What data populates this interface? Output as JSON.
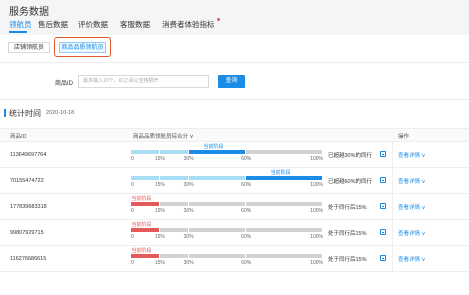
{
  "page_title": "服务数据",
  "nav": {
    "tabs": [
      "领航员",
      "售后数据",
      "评价数据",
      "客服数据",
      "消费者体验指标"
    ]
  },
  "subtabs": [
    "店铺领航员",
    "商品品质领航员"
  ],
  "search": {
    "label": "商品ID",
    "placeholder": "最多输入10个，ID之间以空格隔开",
    "button": "查询"
  },
  "stats": {
    "title": "统计时间",
    "date": "2020-10-18"
  },
  "table": {
    "headers": [
      "商品ID",
      "商品品质领航员综合分 ∨",
      "操作"
    ],
    "stage_label": "当前阶段",
    "ticks": [
      "0",
      "15%",
      "30%",
      "60%",
      "100%"
    ],
    "action_label": "查看详情 ∨",
    "rows": [
      {
        "id": "113649697764",
        "status": "已超越30%的同行",
        "stage_index": 2,
        "tone": "blue"
      },
      {
        "id": "70155474722",
        "status": "已超越60%的同行",
        "stage_index": 3,
        "tone": "blue"
      },
      {
        "id": "177839683318",
        "status": "处于同行后15%",
        "stage_index": 0,
        "tone": "red"
      },
      {
        "id": "99807929715",
        "status": "处于同行后15%",
        "stage_index": 0,
        "tone": "red"
      },
      {
        "id": "116276686615",
        "status": "处于同行后15%",
        "stage_index": 0,
        "tone": "red"
      }
    ]
  },
  "colors": {
    "accent": "#1a8ce8",
    "light_blue": "#a9dcf5",
    "red": "#e45a5a",
    "grey": "#d2d2d2"
  }
}
